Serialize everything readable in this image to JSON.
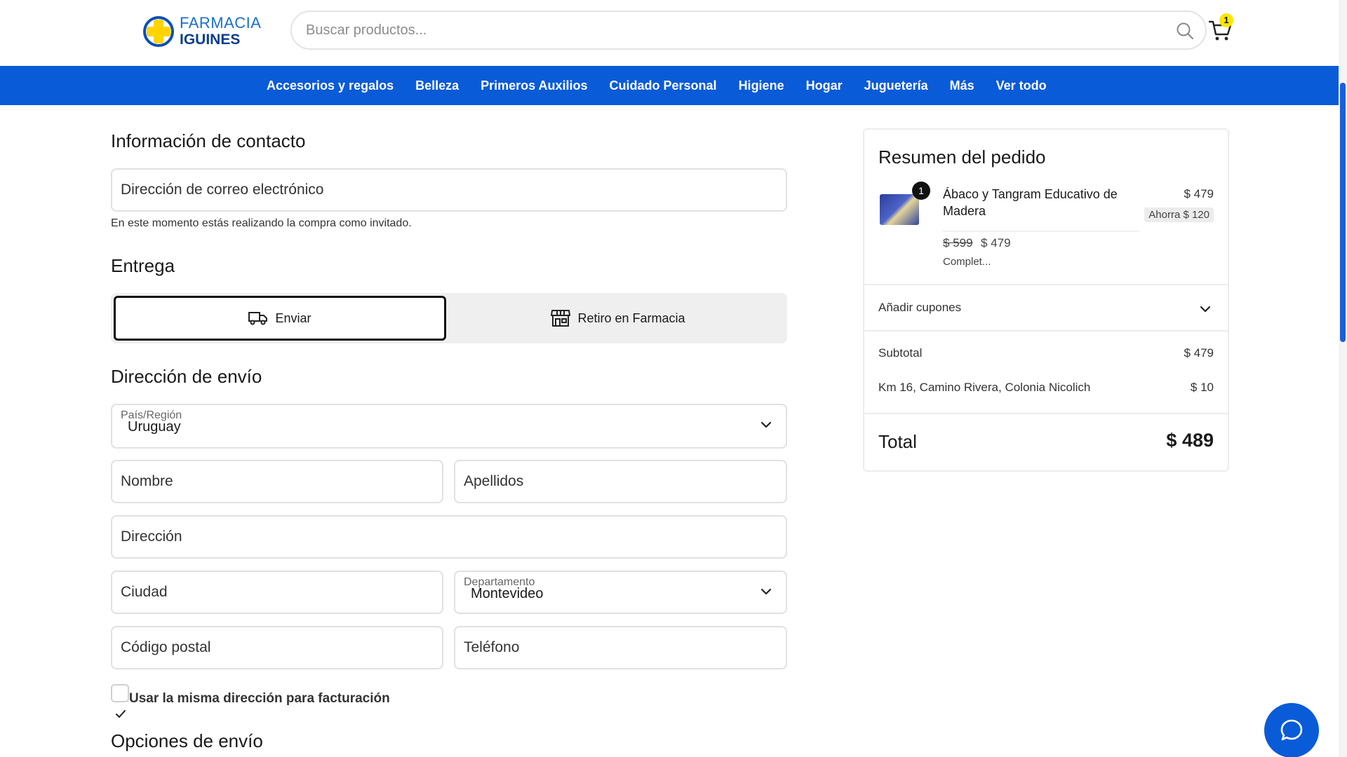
{
  "header": {
    "logo_line1": "FARMACIA",
    "logo_line2": "IGUINES",
    "search_placeholder": "Buscar productos...",
    "cart_count": "1"
  },
  "nav": {
    "items": [
      "Accesorios y regalos",
      "Belleza",
      "Primeros Auxilios",
      "Cuidado Personal",
      "Higiene",
      "Hogar",
      "Juguetería",
      "Más",
      "Ver todo"
    ]
  },
  "contact": {
    "title": "Información de contacto",
    "email_placeholder": "Dirección de correo electrónico",
    "guest_note": "En este momento estás realizando la compra como invitado."
  },
  "delivery": {
    "title": "Entrega",
    "ship_label": "Enviar",
    "pickup_label": "Retiro en Farmacia",
    "selected": "Enviar"
  },
  "shipping_address": {
    "title": "Dirección de envío",
    "country_label": "País/Región",
    "country_value": "Uruguay",
    "first_name_placeholder": "Nombre",
    "last_name_placeholder": "Apellidos",
    "address_placeholder": "Dirección",
    "city_placeholder": "Ciudad",
    "department_label": "Departamento",
    "department_value": "Montevideo",
    "postal_placeholder": "Código postal",
    "phone_placeholder": "Teléfono",
    "same_billing_label": "Usar la misma dirección para facturación",
    "same_billing_checked": true
  },
  "shipping_options": {
    "title": "Opciones de envío"
  },
  "summary": {
    "title": "Resumen del pedido",
    "product": {
      "qty": "1",
      "name": "Ábaco y Tangram Educativo de Madera",
      "price": "$ 479",
      "savings": "Ahorra $ 120",
      "old_price": "$ 599",
      "new_price": "$ 479",
      "note": "Complet..."
    },
    "coupons_label": "Añadir cupones",
    "subtotal_label": "Subtotal",
    "subtotal_value": "$ 479",
    "shipping_label": "Km 16, Camino Rivera, Colonia Nicolich",
    "shipping_value": "$ 10",
    "total_label": "Total",
    "total_value": "$ 489"
  },
  "colors": {
    "brand_blue": "#0a5bd8",
    "cart_badge": "#ffe600"
  }
}
